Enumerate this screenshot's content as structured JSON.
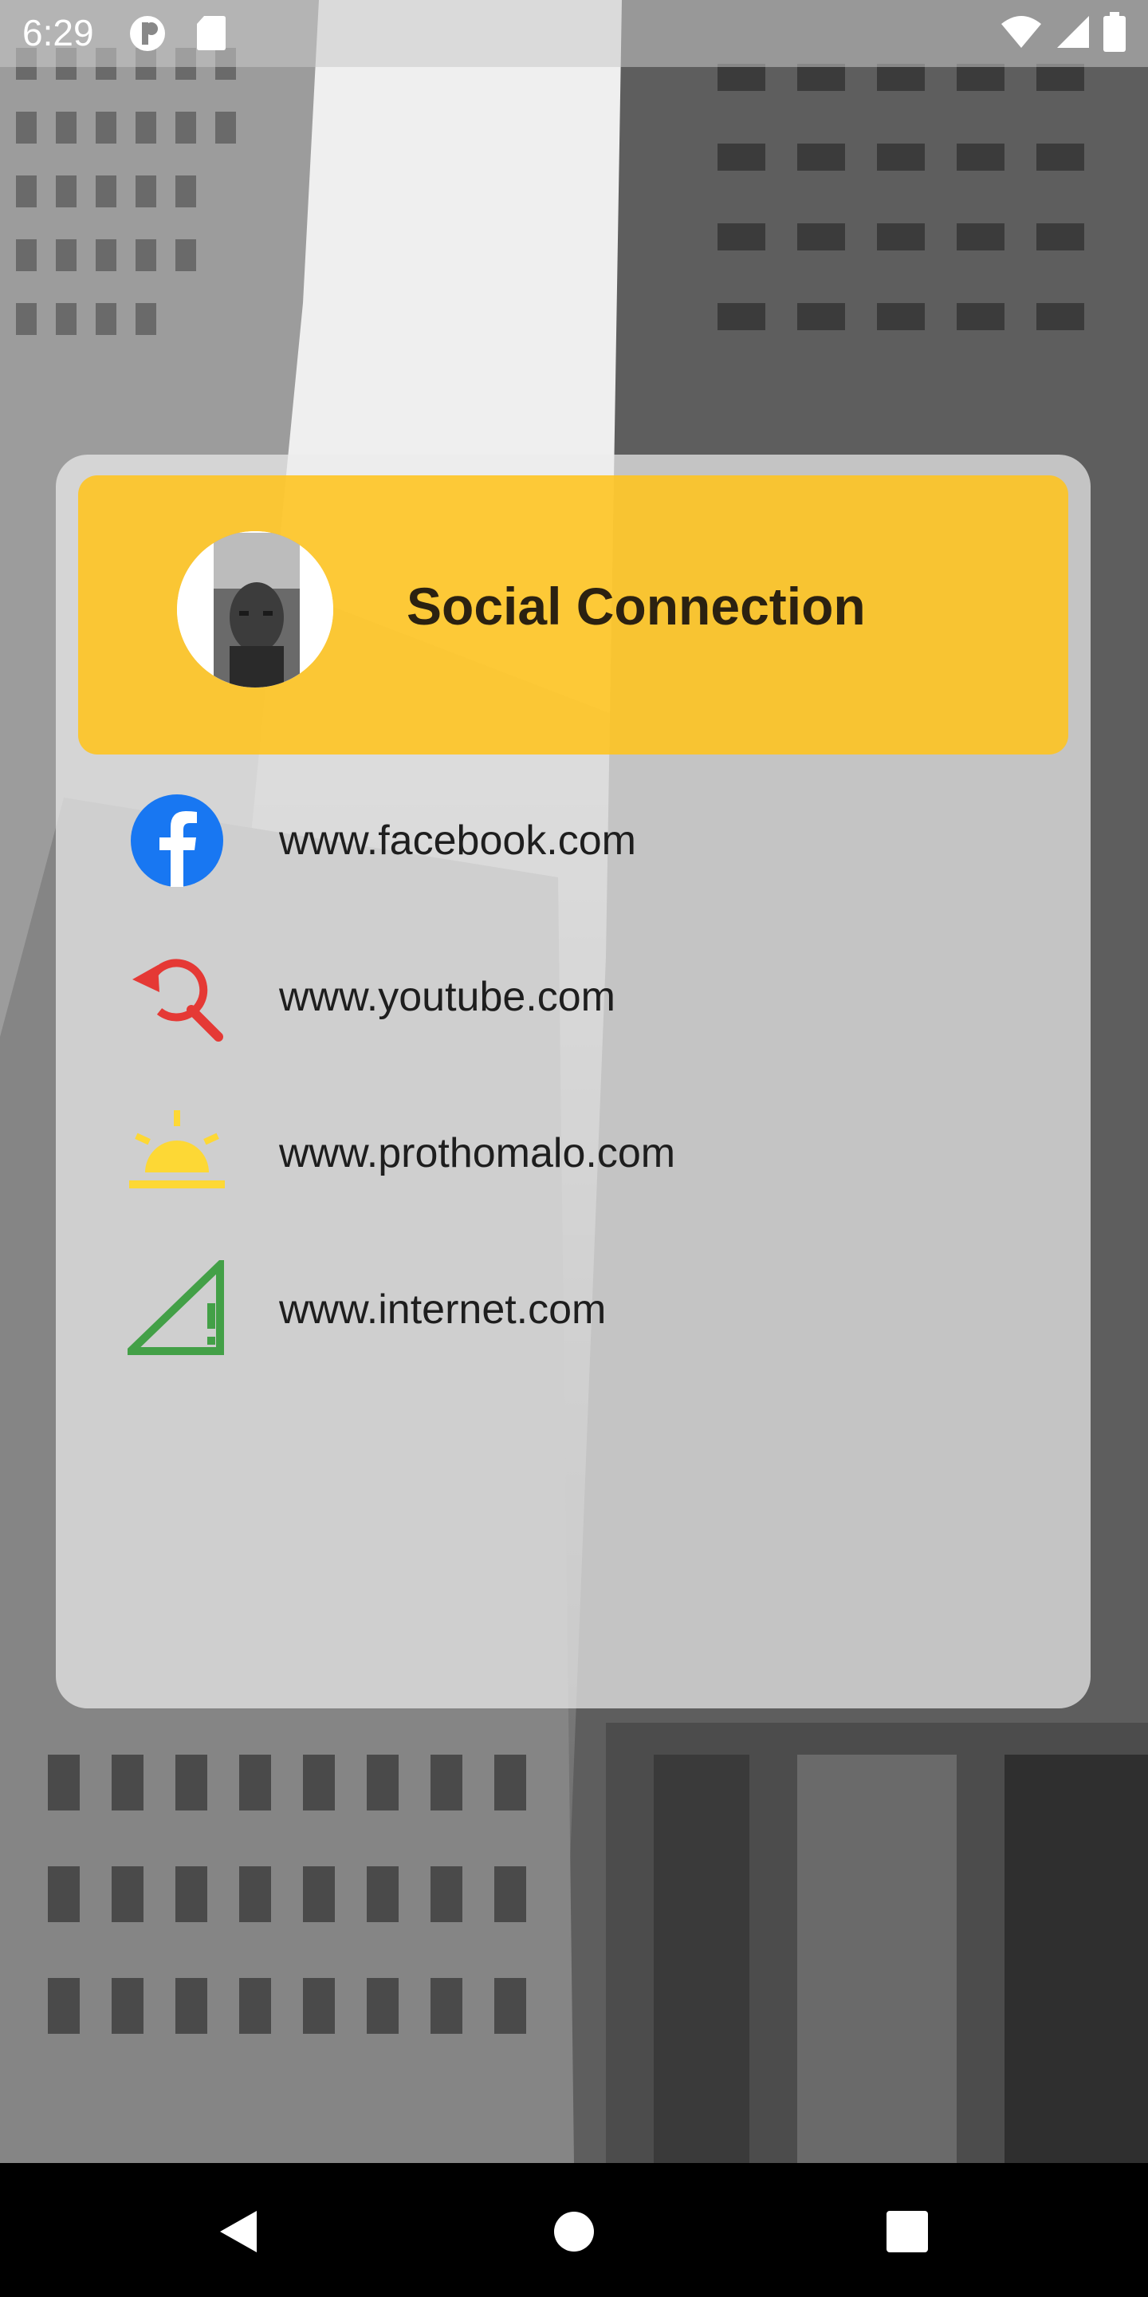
{
  "status_bar": {
    "time": "6:29",
    "icons": [
      "app-notification-icon",
      "sd-card-icon",
      "wifi-icon",
      "cell-signal-icon",
      "battery-icon"
    ]
  },
  "header": {
    "title": "Social Connection",
    "avatar": "profile-photo"
  },
  "links": [
    {
      "label": "www.facebook.com",
      "icon": "facebook-icon"
    },
    {
      "label": "www.youtube.com",
      "icon": "search-refresh-icon"
    },
    {
      "label": "www.prothomalo.com",
      "icon": "sunrise-icon"
    },
    {
      "label": "www.internet.com",
      "icon": "signal-icon"
    }
  ],
  "nav_bar": {
    "buttons": [
      "back-icon",
      "home-icon",
      "recents-icon"
    ]
  },
  "colors": {
    "header_accent": "#FFC41E",
    "facebook_blue": "#1877F2",
    "youtube_red": "#E53935",
    "sunrise_yellow": "#FDD835",
    "signal_green": "#43A047"
  }
}
